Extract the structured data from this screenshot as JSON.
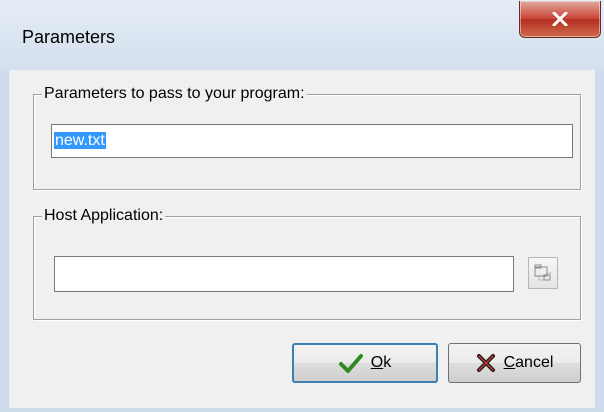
{
  "window": {
    "title": "Parameters",
    "close_label": "x"
  },
  "params_group": {
    "label": "Parameters to pass to your program:",
    "value": "new.txt"
  },
  "host_group": {
    "label": "Host Application:",
    "value": ""
  },
  "buttons": {
    "ok_mnemonic": "O",
    "ok_rest": "k",
    "cancel_mnemonic": "C",
    "cancel_rest": "ancel"
  },
  "icons": {
    "ok": "checkmark-icon",
    "cancel": "x-cross-icon",
    "browse": "folder-browse-icon"
  },
  "colors": {
    "selection": "#3399ff",
    "close_button": "#c9483a",
    "ok_check": "#2e8b1f",
    "cancel_x": "#1a1a1a"
  }
}
